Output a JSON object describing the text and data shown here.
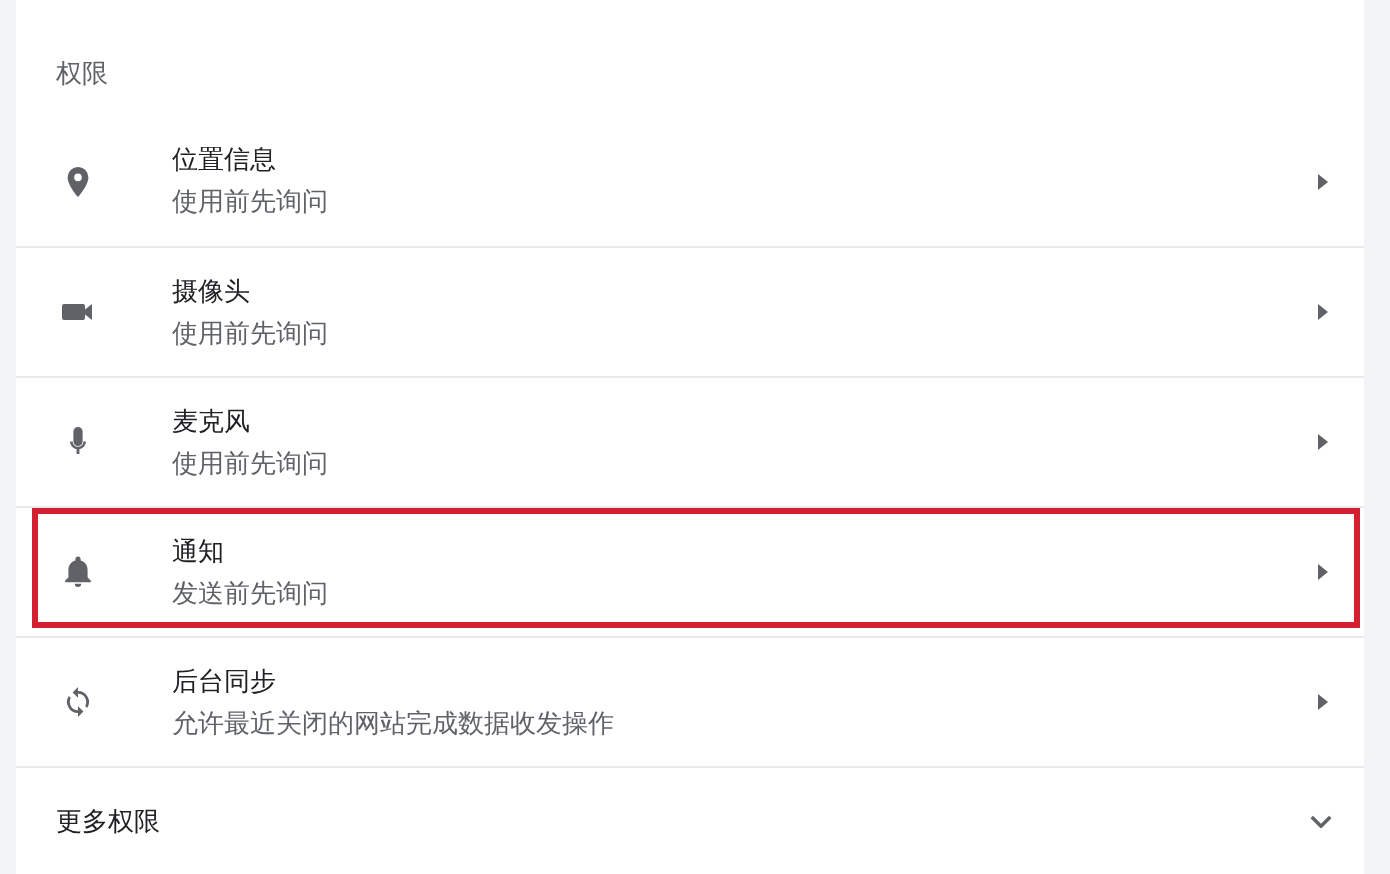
{
  "section_title": "权限",
  "permissions": [
    {
      "title": "位置信息",
      "subtitle": "使用前先询问",
      "highlighted": false
    },
    {
      "title": "摄像头",
      "subtitle": "使用前先询问",
      "highlighted": false
    },
    {
      "title": "麦克风",
      "subtitle": "使用前先询问",
      "highlighted": false
    },
    {
      "title": "通知",
      "subtitle": "发送前先询问",
      "highlighted": true
    },
    {
      "title": "后台同步",
      "subtitle": "允许最近关闭的网站完成数据收发操作",
      "highlighted": false
    }
  ],
  "more": {
    "label": "更多权限",
    "expanded": false
  }
}
